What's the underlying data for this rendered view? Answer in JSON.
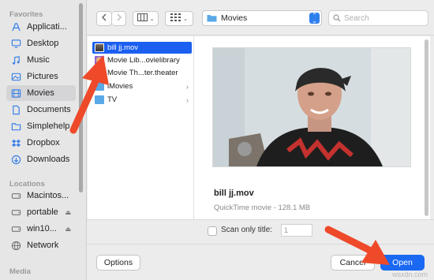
{
  "sidebar": {
    "sections": [
      {
        "title": "Favorites",
        "items": [
          {
            "label": "Applicati...",
            "icon": "applications-icon"
          },
          {
            "label": "Desktop",
            "icon": "desktop-icon"
          },
          {
            "label": "Music",
            "icon": "music-icon"
          },
          {
            "label": "Pictures",
            "icon": "pictures-icon"
          },
          {
            "label": "Movies",
            "icon": "movies-icon",
            "selected": true
          },
          {
            "label": "Documents",
            "icon": "documents-icon"
          },
          {
            "label": "Simplehelp",
            "icon": "folder-icon"
          },
          {
            "label": "Dropbox",
            "icon": "dropbox-icon"
          },
          {
            "label": "Downloads",
            "icon": "downloads-icon"
          }
        ]
      },
      {
        "title": "Locations",
        "items": [
          {
            "label": "Macintos...",
            "icon": "hard-disk-icon"
          },
          {
            "label": "portable",
            "icon": "external-disk-icon"
          },
          {
            "label": "win10...",
            "icon": "external-disk-icon"
          },
          {
            "label": "Network",
            "icon": "network-icon"
          }
        ]
      },
      {
        "title": "Media",
        "items": []
      }
    ]
  },
  "toolbar": {
    "back_icon": "chevron-left-icon",
    "forward_icon": "chevron-right-icon",
    "view_icon": "column-view-icon",
    "group_icon": "grid-view-icon",
    "location": "Movies",
    "search_placeholder": "Search"
  },
  "files": [
    {
      "name": "bill jj.mov",
      "icon": "video-file-icon",
      "selected": true,
      "folder": false
    },
    {
      "name": "Movie Lib...ovielibrary",
      "icon": "imovie-library-icon",
      "selected": false,
      "folder": false
    },
    {
      "name": "Movie Th...ter.theater",
      "icon": "imovie-theater-icon",
      "selected": false,
      "folder": false
    },
    {
      "name": "iMovies",
      "icon": "folder-icon",
      "selected": false,
      "folder": true
    },
    {
      "name": "TV",
      "icon": "folder-icon",
      "selected": false,
      "folder": true
    }
  ],
  "preview": {
    "name": "bill jj.mov",
    "info": "QuickTime movie - 128.1 MB"
  },
  "options": {
    "scan_label": "Scan only title:",
    "scan_value": "1",
    "scan_checked": false
  },
  "buttons": {
    "options": "Options",
    "cancel": "Cancel",
    "open": "Open"
  },
  "watermark": "wsxdn.com",
  "colors": {
    "accent": "#1b5ff0",
    "annotation_arrow": "#ee4a2a",
    "folder_blue": "#5aa8e6"
  }
}
